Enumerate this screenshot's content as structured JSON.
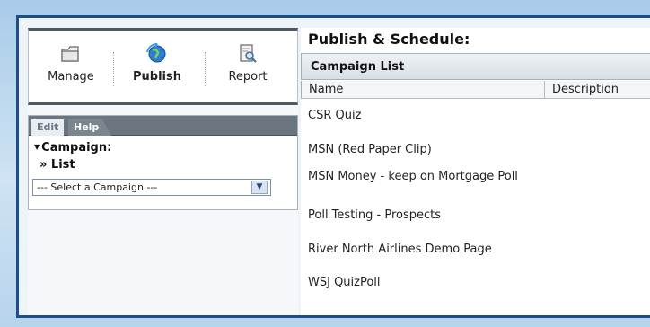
{
  "toolbar": {
    "manage_label": "Manage",
    "publish_label": "Publish",
    "report_label": "Report",
    "manage_icon": "folder-icon",
    "publish_icon": "globe-refresh-icon",
    "report_icon": "report-magnifier-icon"
  },
  "sidebar": {
    "tabs": [
      {
        "label": "Edit"
      },
      {
        "label": "Help"
      }
    ],
    "campaign_label": "Campaign:",
    "list_label": "» List",
    "select_value": "--- Select a Campaign ---"
  },
  "main": {
    "title": "Publish & Schedule:",
    "campaign_list_title": "Campaign List",
    "columns": [
      "Name",
      "Description"
    ],
    "campaigns": [
      {
        "name": "CSR Quiz",
        "description": ""
      },
      {
        "name": "MSN (Red Paper Clip)",
        "description": ""
      },
      {
        "name": "MSN Money - keep on Mortgage Poll",
        "description": ""
      },
      {
        "name": "Poll Testing - Prospects",
        "description": ""
      },
      {
        "name": "River North Airlines Demo Page",
        "description": ""
      },
      {
        "name": "WSJ QuizPoll",
        "description": ""
      }
    ]
  },
  "colors": {
    "frame_border": "#1a4f8a",
    "frame_bg": "#cfe3f3",
    "tab_bar": "#6b7580"
  }
}
